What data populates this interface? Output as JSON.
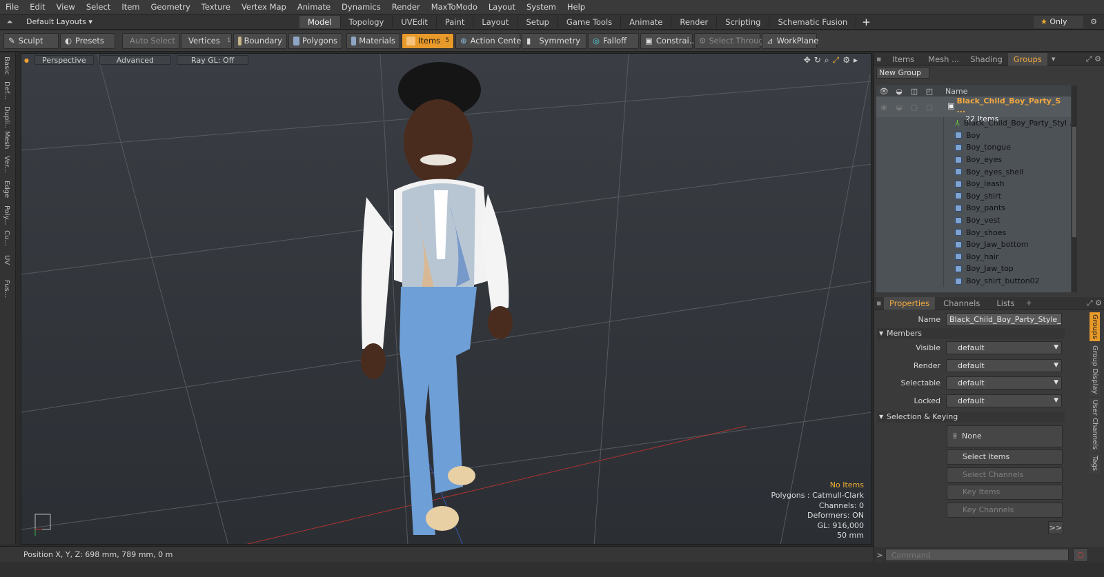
{
  "menu": [
    "File",
    "Edit",
    "View",
    "Select",
    "Item",
    "Geometry",
    "Texture",
    "Vertex Map",
    "Animate",
    "Dynamics",
    "Render",
    "MaxToModo",
    "Layout",
    "System",
    "Help"
  ],
  "layout": {
    "name": "Default Layouts",
    "tabs": [
      "Model",
      "Topology",
      "UVEdit",
      "Paint",
      "Layout",
      "Setup",
      "Game Tools",
      "Animate",
      "Render",
      "Scripting",
      "Schematic Fusion"
    ],
    "active_tab": "Model",
    "add": "+",
    "only_label": "Only"
  },
  "toolbar": {
    "sculpt": "Sculpt",
    "presets": "Presets",
    "auto_select": "Auto Select",
    "vertices": "Vertices",
    "vertices_count": "1",
    "boundary": "Boundary",
    "polygons": "Polygons",
    "materials": "Materials",
    "items": "Items",
    "items_count": "5",
    "action_center": "Action Center",
    "symmetry": "Symmetry",
    "falloff": "Falloff",
    "constrain": "Constrai...",
    "select_through": "Select Through",
    "workplane": "WorkPlane"
  },
  "left_tabs": [
    "Basic",
    "Def...",
    "Dupli...",
    "Mesh ...",
    "Ver...",
    "Edge",
    "Poly...",
    "Cu...",
    "UV",
    "Fus..."
  ],
  "viewport": {
    "perspective": "Perspective",
    "advanced": "Advanced",
    "raygl": "Ray GL: Off",
    "hud": {
      "no_items": "No Items",
      "polygons": "Polygons : Catmull-Clark",
      "channels": "Channels: 0",
      "deformers": "Deformers: ON",
      "gl": "GL: 916,000",
      "scale": "50 mm"
    }
  },
  "status": {
    "position": "Position X, Y, Z:  698 mm, 789 mm, 0 m"
  },
  "panel": {
    "tabs": [
      "Items",
      "Mesh ...",
      "Shading",
      "Groups"
    ],
    "active_tab": "Groups",
    "new_group": "New Group",
    "name_col": "Name",
    "group_name": "Black_Child_Boy_Party_S ...",
    "group_count": "22 Items",
    "items": [
      "Black_Child_Boy_Party_Styl ...",
      "Boy",
      "Boy_tongue",
      "Boy_eyes",
      "Boy_eyes_shell",
      "Boy_leash",
      "Boy_shirt",
      "Boy_pants",
      "Boy_vest",
      "Boy_shoes",
      "Boy_Jaw_bottom",
      "Boy_hair",
      "Boy_Jaw_top",
      "Boy_shirt_button02"
    ]
  },
  "properties": {
    "tabs": [
      "Properties",
      "Channels",
      "Lists"
    ],
    "active_tab": "Properties",
    "name_label": "Name",
    "name_value": "Black_Child_Boy_Party_Style_Pos",
    "members": "Members",
    "visible_label": "Visible",
    "render_label": "Render",
    "selectable_label": "Selectable",
    "locked_label": "Locked",
    "default": "default",
    "selection_keying": "Selection & Keying",
    "none": "None",
    "select_items": "Select Items",
    "select_channels": "Select Channels",
    "key_items": "Key Items",
    "key_channels": "Key Channels",
    "more": ">>",
    "side_tabs": [
      "Groups",
      "Group Display",
      "User Channels",
      "Tags"
    ],
    "command_placeholder": "Command"
  },
  "colors": {
    "accent": "#e79a2a",
    "selection": "#f0a840"
  }
}
